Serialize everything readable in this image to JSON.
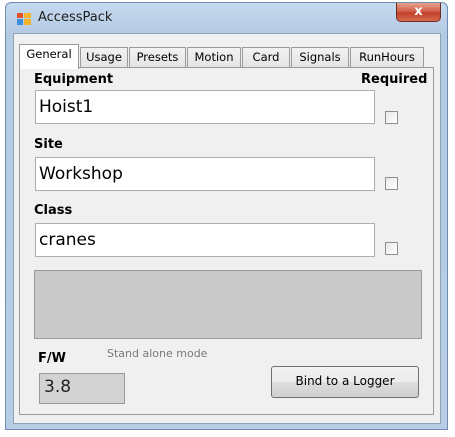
{
  "window": {
    "title": "AccessPack",
    "close_label": "x"
  },
  "tabs": [
    {
      "label": "General",
      "active": true
    },
    {
      "label": "Usage"
    },
    {
      "label": "Presets"
    },
    {
      "label": "Motion"
    },
    {
      "label": "Card"
    },
    {
      "label": "Signals"
    },
    {
      "label": "RunHours"
    }
  ],
  "general": {
    "required_label": "Required",
    "fields": [
      {
        "label": "Equipment",
        "value": "Hoist1",
        "required": false
      },
      {
        "label": "Site",
        "value": "Workshop",
        "required": false
      },
      {
        "label": "Class",
        "value": "cranes",
        "required": false
      }
    ],
    "mode_text": "Stand alone mode",
    "fw_label": "F/W",
    "fw_value": "3.8",
    "bind_button_label": "Bind to a Logger"
  }
}
